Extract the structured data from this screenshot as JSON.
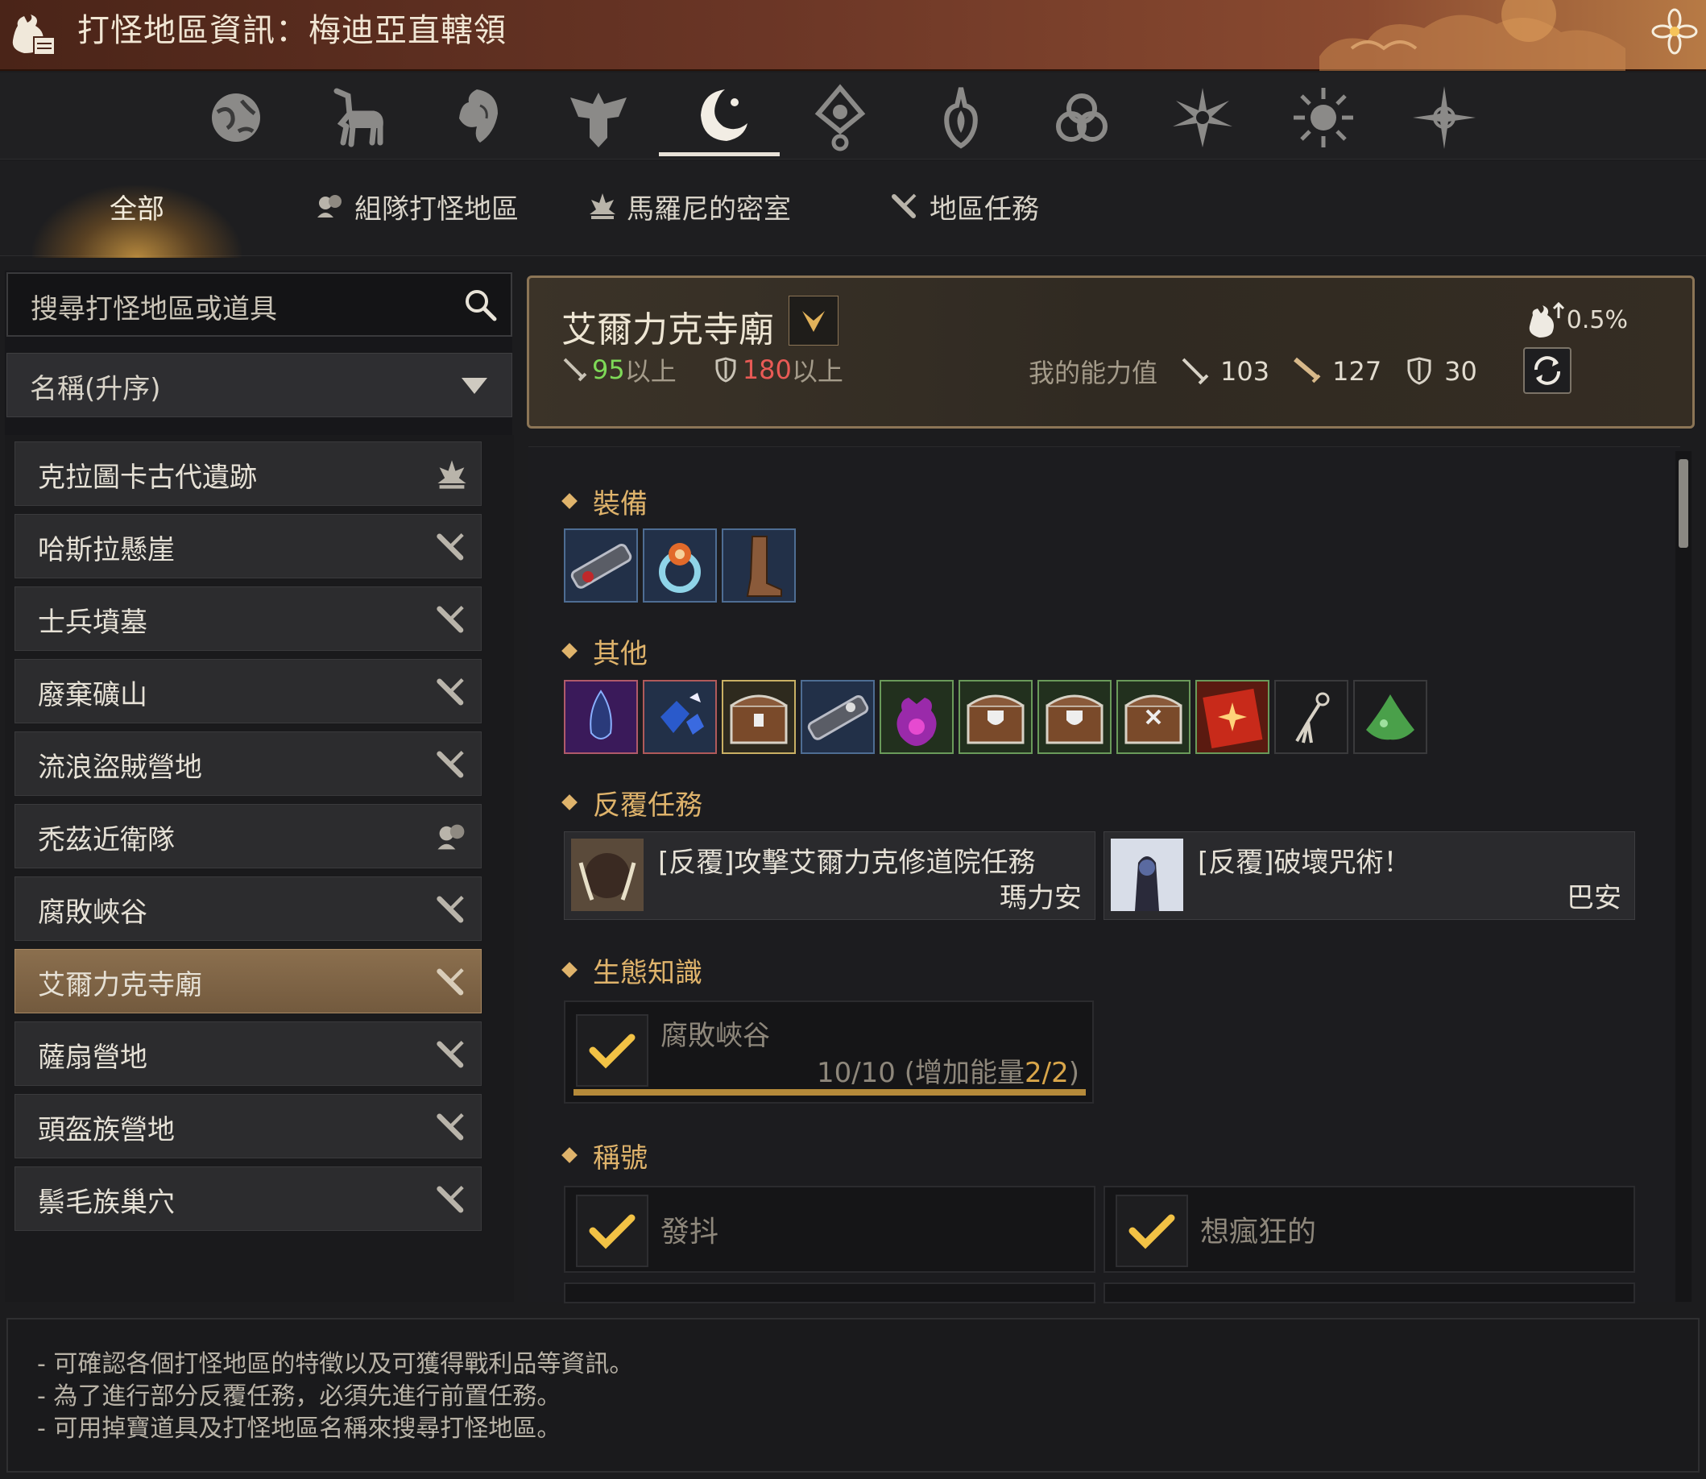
{
  "window": {
    "title": "打怪地區資訊：梅迪亞直轄領",
    "icons": {
      "title": "loot-bag-icon",
      "close": "flower-close-icon"
    }
  },
  "categories": [
    {
      "icon": "globe-icon"
    },
    {
      "icon": "horse-icon"
    },
    {
      "icon": "lion-icon"
    },
    {
      "icon": "eagle-crest-icon"
    },
    {
      "icon": "crescent-moon-icon",
      "active": true
    },
    {
      "icon": "eye-diamond-icon"
    },
    {
      "icon": "flame-crest-icon"
    },
    {
      "icon": "triquetra-icon"
    },
    {
      "icon": "star-burst-icon"
    },
    {
      "icon": "sun-icon"
    },
    {
      "icon": "compass-star-icon"
    }
  ],
  "filters": {
    "all": "全部",
    "party": "組隊打怪地區",
    "marni": "馬羅尼的密室",
    "quest": "地區任務"
  },
  "search": {
    "placeholder": "搜尋打怪地區或道具"
  },
  "sort": {
    "value": "名稱(升序)"
  },
  "zones": [
    {
      "label": "克拉圖卡古代遺跡",
      "icon": "marni-icon"
    },
    {
      "label": "哈斯拉懸崖",
      "icon": "quest-scroll-icon"
    },
    {
      "label": "士兵墳墓",
      "icon": "quest-scroll-icon"
    },
    {
      "label": "廢棄礦山",
      "icon": "quest-scroll-icon"
    },
    {
      "label": "流浪盜賊營地",
      "icon": "quest-scroll-icon"
    },
    {
      "label": "禿茲近衛隊",
      "icon": "party-icon"
    },
    {
      "label": "腐敗峽谷",
      "icon": "quest-scroll-icon"
    },
    {
      "label": "艾爾力克寺廟",
      "icon": "quest-scroll-icon",
      "selected": true
    },
    {
      "label": "薩扇營地",
      "icon": "quest-scroll-icon"
    },
    {
      "label": "頭盔族營地",
      "icon": "quest-scroll-icon"
    },
    {
      "label": "鬃毛族巢穴",
      "icon": "quest-scroll-icon"
    }
  ],
  "detail": {
    "name": "艾爾力克寺廟",
    "req_ap": "95",
    "req_ap_suffix": "以上",
    "req_dp": "180",
    "req_dp_suffix": "以上",
    "my_stats_label": "我的能力值",
    "my_ap": "103",
    "my_awaken_ap": "127",
    "my_dp": "30",
    "drop_rate": "0.5%"
  },
  "sections": {
    "equipment": "裝備",
    "other": "其他",
    "repeat_quests": "反覆任務",
    "knowledge": "生態知識",
    "titles": "稱號"
  },
  "equipment_items": [
    "belt-icon",
    "ring-icon",
    "boots-icon"
  ],
  "other_items": [
    "black-stone-icon",
    "crystal-icon",
    "chest-icon",
    "belt-icon",
    "pouch-icon",
    "chest-icon",
    "chest-icon",
    "chest-icon",
    "red-book-icon",
    "claw-icon",
    "green-slime-icon"
  ],
  "quests": [
    {
      "title": "[反覆]攻擊艾爾力克修道院任務",
      "npc": "瑪力安"
    },
    {
      "title": "[反覆]破壞咒術！",
      "npc": "巴安"
    }
  ],
  "knowledge": {
    "name": "腐敗峽谷",
    "progress": "10/10 (增加能量",
    "energy": "2/2",
    "close": ")",
    "fill": 1.0
  },
  "titles": [
    "發抖",
    "想瘋狂的"
  ],
  "info_lines": [
    "- 可確認各個打怪地區的特徵以及可獲得戰利品等資訊。",
    "- 為了進行部分反覆任務，必須先進行前置任務。",
    "- 可用掉寶道具及打怪地區名稱來搜尋打怪地區。"
  ],
  "colors": {
    "accent": "#dfb36b",
    "selected_row": "#8b6f4e",
    "req_ok": "#7ed957",
    "req_bad": "#e85a55"
  }
}
